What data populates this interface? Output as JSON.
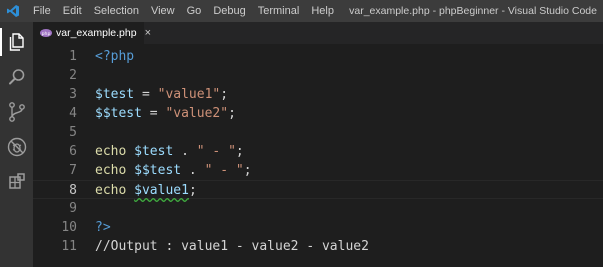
{
  "titlebar": {
    "menu": [
      "File",
      "Edit",
      "Selection",
      "View",
      "Go",
      "Debug",
      "Terminal",
      "Help"
    ],
    "window_title": "var_example.php - phpBeginner - Visual Studio Code"
  },
  "activitybar": {
    "icons": [
      "files-icon",
      "search-icon",
      "source-control-icon",
      "debug-icon",
      "extensions-icon"
    ]
  },
  "tab": {
    "label": "var_example.php",
    "close": "×"
  },
  "editor": {
    "lines": [
      {
        "n": "1",
        "tokens": [
          {
            "t": "<?php",
            "c": "t-tag"
          }
        ]
      },
      {
        "n": "2",
        "tokens": []
      },
      {
        "n": "3",
        "tokens": [
          {
            "t": "$test",
            "c": "t-var"
          },
          {
            "t": " = ",
            "c": "t-op"
          },
          {
            "t": "\"value1\"",
            "c": "t-str"
          },
          {
            "t": ";",
            "c": "t-op"
          }
        ]
      },
      {
        "n": "4",
        "tokens": [
          {
            "t": "$$test",
            "c": "t-var"
          },
          {
            "t": " = ",
            "c": "t-op"
          },
          {
            "t": "\"value2\"",
            "c": "t-str"
          },
          {
            "t": ";",
            "c": "t-op"
          }
        ]
      },
      {
        "n": "5",
        "tokens": []
      },
      {
        "n": "6",
        "tokens": [
          {
            "t": "echo ",
            "c": "t-kw"
          },
          {
            "t": "$test",
            "c": "t-var"
          },
          {
            "t": " . ",
            "c": "t-op"
          },
          {
            "t": "\" - \"",
            "c": "t-str"
          },
          {
            "t": ";",
            "c": "t-op"
          }
        ]
      },
      {
        "n": "7",
        "tokens": [
          {
            "t": "echo ",
            "c": "t-kw"
          },
          {
            "t": "$$test",
            "c": "t-var"
          },
          {
            "t": " . ",
            "c": "t-op"
          },
          {
            "t": "\" - \"",
            "c": "t-str"
          },
          {
            "t": ";",
            "c": "t-op"
          }
        ]
      },
      {
        "n": "8",
        "tokens": [
          {
            "t": "echo ",
            "c": "t-kw"
          },
          {
            "t": "$value1",
            "c": "t-var squiggle"
          },
          {
            "t": ";",
            "c": "t-op"
          }
        ],
        "current": true
      },
      {
        "n": "9",
        "tokens": []
      },
      {
        "n": "10",
        "tokens": [
          {
            "t": "?>",
            "c": "t-tag"
          }
        ]
      },
      {
        "n": "11",
        "tokens": [
          {
            "t": "//Output : value1 - value2 - value2",
            "c": "t-cmt"
          }
        ]
      }
    ]
  },
  "colors": {
    "accent": "#007acc",
    "editor_bg": "#1e1e1e"
  }
}
